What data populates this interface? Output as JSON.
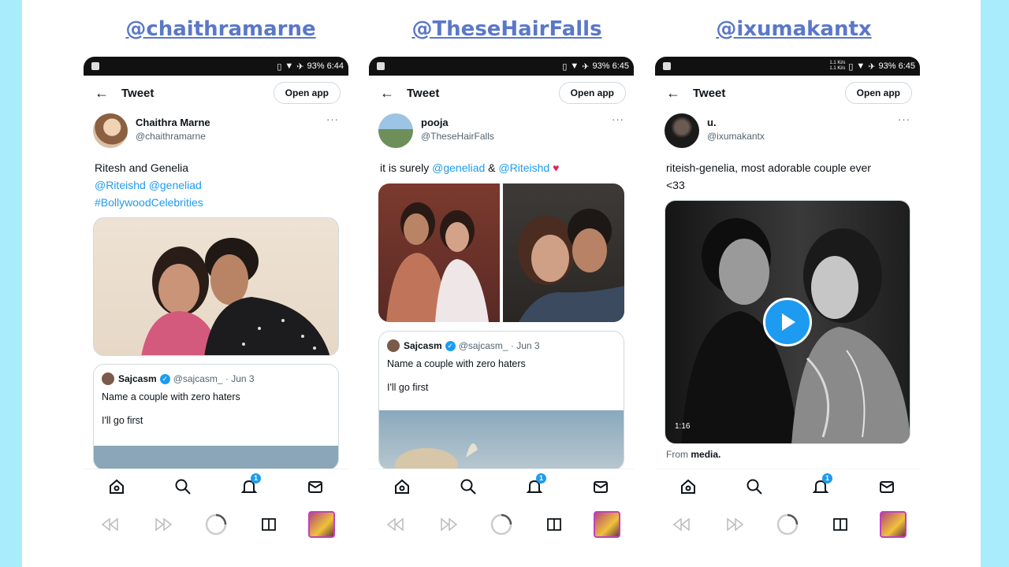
{
  "headers": [
    "@chaithramarne",
    "@TheseHairFalls",
    "@ixumakantx"
  ],
  "common": {
    "back_icon": "←",
    "title": "Tweet",
    "open_app": "Open app",
    "more": "···",
    "notif_badge": "1",
    "verified_glyph": "✓"
  },
  "phones": [
    {
      "status": "93% 6:44",
      "display_name": "Chaithra Marne",
      "username": "@chaithramarne",
      "text_line1": "Ritesh and Genelia",
      "mention1": "@Riteishd",
      "mention2": "@geneliad",
      "hashtag": "#BollywoodCelebrities",
      "quote": {
        "name": "Sajcasm",
        "meta": "@sajcasm_ · Jun 3",
        "line1": "Name a couple with zero haters",
        "line2": "I'll go first"
      }
    },
    {
      "status": "93% 6:45",
      "display_name": "pooja",
      "username": "@TheseHairFalls",
      "text_prefix": "it is surely",
      "mention1": "@geneliad",
      "amp": "&",
      "mention2": "@Riteishd",
      "heart": "♥",
      "quote": {
        "name": "Sajcasm",
        "meta": "@sajcasm_ · Jun 3",
        "line1": "Name a couple with zero haters",
        "line2": "I'll go first"
      }
    },
    {
      "status": "93% 6:45",
      "net_speed_top": "1.1 Ki/s",
      "net_speed_bottom": "1.1 Ki/s",
      "display_name": "u.",
      "username": "@ixumakantx",
      "text_line1": "riteish-genelia, most adorable couple ever",
      "text_line2": "<33",
      "video_duration": "1:16",
      "from_prefix": "From",
      "from_source": "media."
    }
  ],
  "icons": {
    "tabs": [
      "home-icon",
      "search-icon",
      "bell-icon",
      "mail-icon"
    ],
    "nav": [
      "rewind-icon",
      "forward-icon",
      "loading-circle-icon",
      "book-icon",
      "profile-avatar"
    ]
  }
}
